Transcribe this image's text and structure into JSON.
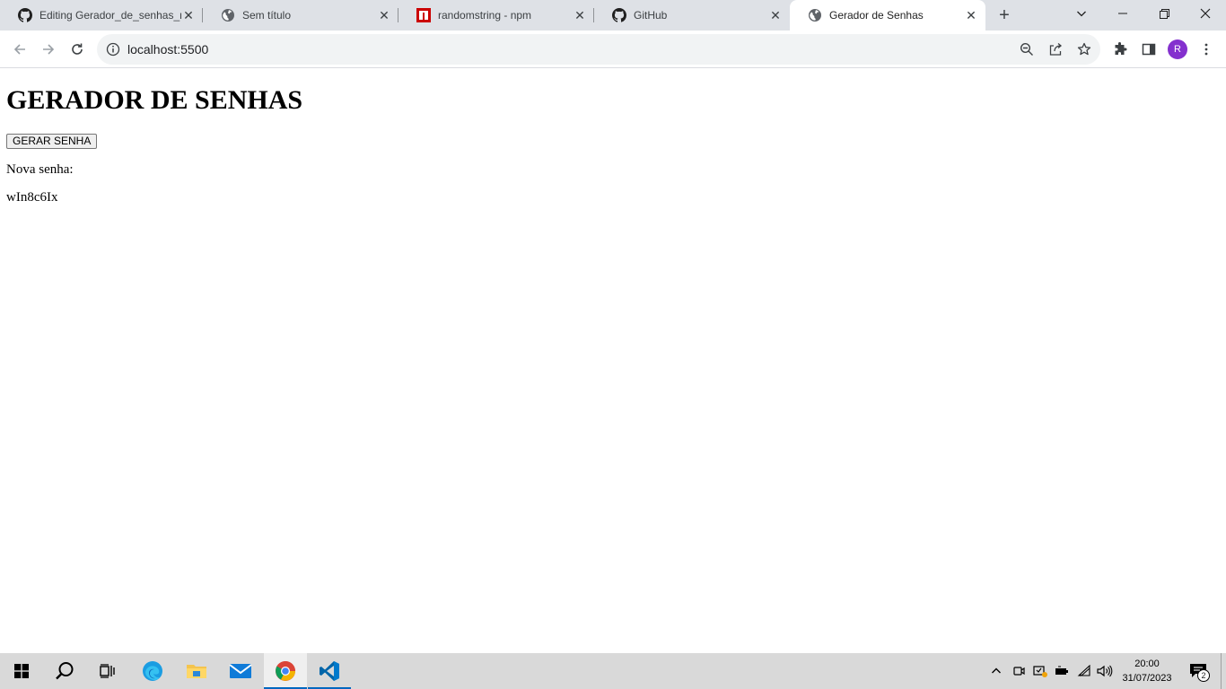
{
  "browser": {
    "tabs": [
      {
        "title": "Editing Gerador_de_senhas_n",
        "favicon": "github-icon",
        "active": false
      },
      {
        "title": "Sem título",
        "favicon": "globe-icon",
        "active": false
      },
      {
        "title": "randomstring - npm",
        "favicon": "npm-icon",
        "active": false
      },
      {
        "title": "GitHub",
        "favicon": "github-icon",
        "active": false
      },
      {
        "title": "Gerador de Senhas",
        "favicon": "globe-icon",
        "active": true
      }
    ],
    "close_glyph": "✕",
    "new_tab_glyph": "+",
    "url": "localhost:5500",
    "profile_initial": "R",
    "colors": {
      "tabstrip": "#dee1e6",
      "avatar": "#8430ce",
      "omnibox": "#f1f3f4"
    }
  },
  "page": {
    "heading": "GERADOR DE SENHAS",
    "button_label": "GERAR SENHA",
    "new_password_label": "Nova senha:",
    "password": "wIn8c6Ix"
  },
  "taskbar": {
    "time": "20:00",
    "date": "31/07/2023",
    "notification_count": "2",
    "colors": {
      "bar": "#d9d9d9",
      "running_indicator": "#0067c0"
    }
  }
}
